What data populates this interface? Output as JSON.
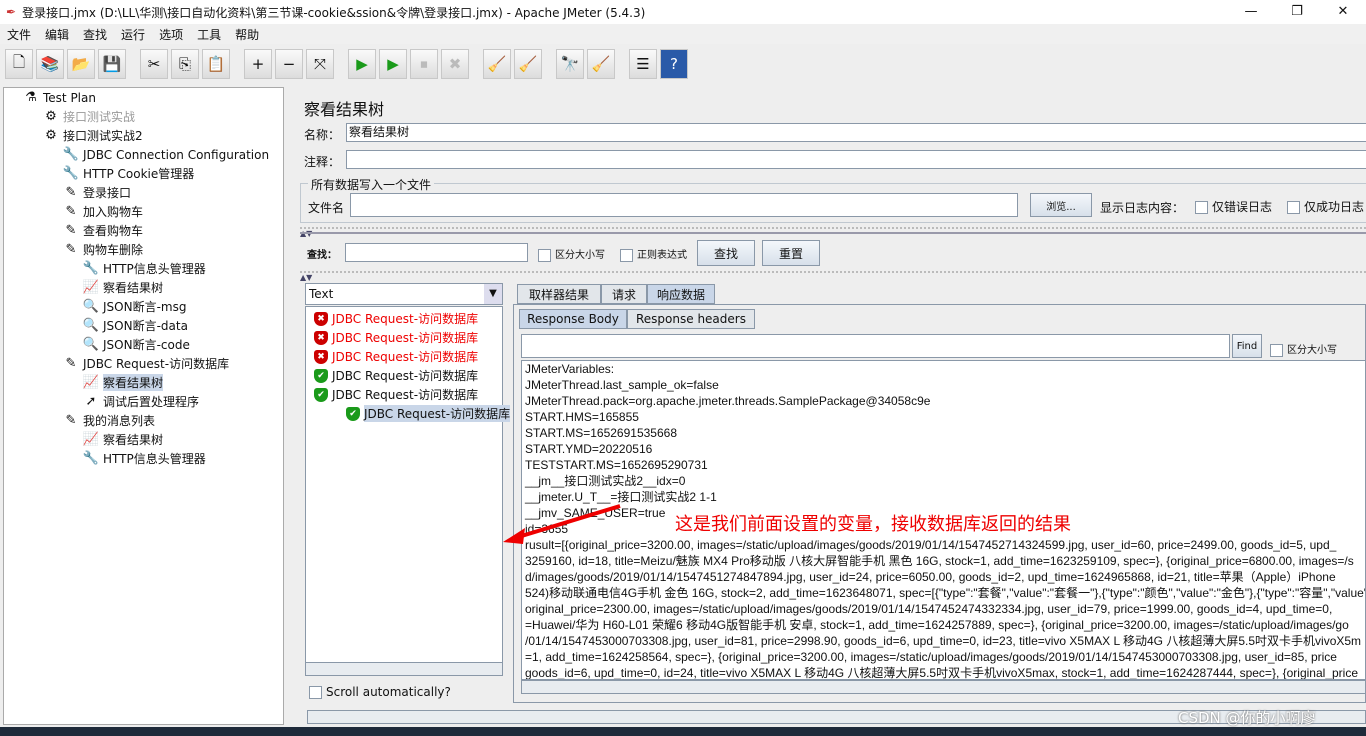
{
  "window": {
    "title": "登录接口.jmx (D:\\LL\\华测\\接口自动化资料\\第三节课-cookie&ssion&令牌\\登录接口.jmx) - Apache JMeter (5.4.3)",
    "min": "—",
    "max": "❐",
    "close": "✕"
  },
  "menu": [
    "文件",
    "编辑",
    "查找",
    "运行",
    "选项",
    "工具",
    "帮助"
  ],
  "toolbar": [
    "new-icon",
    "templates-icon",
    "open-icon",
    "save-icon",
    "cut-icon",
    "copy-icon",
    "paste-icon",
    "expand-icon",
    "collapse-icon",
    "toggle-icon",
    "start-icon",
    "start-no-pause-icon",
    "stop-icon",
    "shutdown-icon",
    "clear-icon",
    "clear-all-icon",
    "search-icon",
    "reset-search-icon",
    "function-helper-icon",
    "help-icon"
  ],
  "tree": [
    {
      "label": "Test Plan",
      "level": 0,
      "icon": "flask"
    },
    {
      "label": "接口测试实战",
      "level": 1,
      "icon": "gear",
      "disabled": true
    },
    {
      "label": "接口测试实战2",
      "level": 1,
      "icon": "gear"
    },
    {
      "label": "JDBC Connection Configuration",
      "level": 2,
      "icon": "wrench"
    },
    {
      "label": "HTTP Cookie管理器",
      "level": 2,
      "icon": "wrench"
    },
    {
      "label": "登录接口",
      "level": 2,
      "icon": "pipette"
    },
    {
      "label": "加入购物车",
      "level": 2,
      "icon": "pipette"
    },
    {
      "label": "查看购物车",
      "level": 2,
      "icon": "pipette"
    },
    {
      "label": "购物车删除",
      "level": 2,
      "icon": "pipette"
    },
    {
      "label": "HTTP信息头管理器",
      "level": 3,
      "icon": "wrench"
    },
    {
      "label": "察看结果树",
      "level": 3,
      "icon": "graph"
    },
    {
      "label": "JSON断言-msg",
      "level": 3,
      "icon": "magnifier"
    },
    {
      "label": "JSON断言-data",
      "level": 3,
      "icon": "magnifier"
    },
    {
      "label": "JSON断言-code",
      "level": 3,
      "icon": "magnifier"
    },
    {
      "label": "JDBC Request-访问数据库",
      "level": 2,
      "icon": "pipette"
    },
    {
      "label": "察看结果树",
      "level": 3,
      "icon": "graph",
      "selected": true
    },
    {
      "label": "调试后置处理程序",
      "level": 3,
      "icon": "arrow"
    },
    {
      "label": "我的消息列表",
      "level": 2,
      "icon": "pipette"
    },
    {
      "label": "察看结果树",
      "level": 3,
      "icon": "graph"
    },
    {
      "label": "HTTP信息头管理器",
      "level": 3,
      "icon": "wrench"
    }
  ],
  "panel": {
    "title": "察看结果树",
    "name_label": "名称：",
    "name_value": "察看结果树",
    "comment_label": "注释：",
    "file_group": "所有数据写入一个文件",
    "file_label": "文件名",
    "browse": "浏览...",
    "log_label": "显示日志内容：",
    "errors_only": "仅错误日志",
    "success_only": "仅成功日志",
    "search_label": "查找：",
    "case_sensitive": "区分大小写",
    "regex": "正则表达式",
    "search_btn": "查找",
    "reset_btn": "重置",
    "renderer": "Text",
    "results": [
      {
        "label": "JDBC Request-访问数据库",
        "status": "error"
      },
      {
        "label": "JDBC Request-访问数据库",
        "status": "error"
      },
      {
        "label": "JDBC Request-访问数据库",
        "status": "error"
      },
      {
        "label": "JDBC Request-访问数据库",
        "status": "success"
      },
      {
        "label": "JDBC Request-访问数据库",
        "status": "success"
      },
      {
        "label": "JDBC Request-访问数据库",
        "status": "success",
        "selected": true,
        "child": true
      }
    ],
    "scroll_auto": "Scroll automatically?",
    "tabs": [
      "取样器结果",
      "请求",
      "响应数据"
    ],
    "subtabs": [
      "Response Body",
      "Response headers"
    ],
    "find_btn": "Find",
    "find_case": "区分大小写",
    "body_lines": [
      "JMeterVariables:",
      "JMeterThread.last_sample_ok=false",
      "JMeterThread.pack=org.apache.jmeter.threads.SamplePackage@34058c9e",
      "START.HMS=165855",
      "START.MS=1652691535668",
      "START.YMD=20220516",
      "TESTSTART.MS=1652695290731",
      "__jm__接口测试实战2__idx=0",
      "__jmeter.U_T__=接口测试实战2 1-1",
      "__jmv_SAME_USER=true",
      "id=3655",
      "rusult=[{original_price=3200.00, images=/static/upload/images/goods/2019/01/14/1547452714324599.jpg, user_id=60, price=2499.00, goods_id=5, upd_",
      "3259160, id=18, title=Meizu/魅族 MX4 Pro移动版 八核大屏智能手机 黑色 16G, stock=1, add_time=1623259109, spec=}, {original_price=6800.00, images=/s",
      "d/images/goods/2019/01/14/1547451274847894.jpg, user_id=24, price=6050.00, goods_id=2, upd_time=1624965868, id=21, title=苹果（Apple）iPhone",
      "524)移动联通电信4G手机 金色 16G, stock=2, add_time=1623648071, spec=[{\"type\":\"套餐\",\"value\":\"套餐一\"},{\"type\":\"颜色\",\"value\":\"金色\"},{\"type\":\"容量\",\"value\"",
      "original_price=2300.00, images=/static/upload/images/goods/2019/01/14/1547452474332334.jpg, user_id=79, price=1999.00, goods_id=4, upd_time=0,",
      "=Huawei/华为 H60-L01 荣耀6 移动4G版智能手机 安卓, stock=1, add_time=1624257889, spec=}, {original_price=3200.00, images=/static/upload/images/go",
      "/01/14/1547453000703308.jpg, user_id=81, price=2998.90, goods_id=6, upd_time=0, id=23, title=vivo X5MAX L 移动4G 八核超薄大屏5.5吋双卡手机vivoX5m",
      "=1, add_time=1624258564, spec=}, {original_price=3200.00, images=/static/upload/images/goods/2019/01/14/1547453000703308.jpg, user_id=85, price",
      " goods_id=6, upd_time=0, id=24, title=vivo X5MAX L 移动4G 八核超薄大屏5.5吋双卡手机vivoX5max, stock=1, add_time=1624287444, spec=}, {original_price"
    ],
    "annotation": "这是我们前面设置的变量，接收数据库返回的结果"
  },
  "watermark": "CSDN @你的小啊廖"
}
